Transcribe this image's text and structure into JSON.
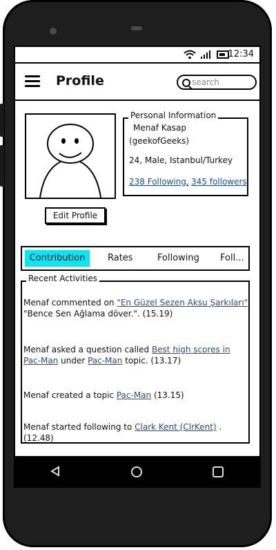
{
  "status_bar": {
    "time": "12:34"
  },
  "app_bar": {
    "title": "Profile",
    "search_placeholder": "search"
  },
  "profile": {
    "edit_button": "Edit Profile",
    "info_legend": "Personal Information",
    "name": "Menaf Kasap",
    "handle": "(geekofGeeks)",
    "details": "24, Male, Istanbul/Turkey",
    "following": "238 Following,",
    "followers": "345 followers"
  },
  "tabs": {
    "contribution": "Contribution",
    "rates": "Rates",
    "following": "Following",
    "followers": "Foll..."
  },
  "activities": {
    "legend": "Recent Activities",
    "items": [
      {
        "pre": "Menaf commented on ",
        "link": "\"En Güzel Sezen Aksu Şarkıları\"",
        "post": ",",
        "line2": "\"Bence Sen Ağlama döver.\". (15.19)"
      },
      {
        "pre": "Menaf asked a question called ",
        "link": "Best high scores in",
        "link2": "Pac-Man",
        "mid": " under ",
        "link3": "Pac-Man",
        "post": " topic. (13.17)"
      },
      {
        "pre": "Menaf created a topic ",
        "link": "Pac-Man",
        "post": " (13.15)"
      },
      {
        "pre": "Menaf started following to ",
        "link": "Clark Kent (ClrKent)",
        "post": " .(12.48)"
      }
    ]
  },
  "icons": {
    "menu": "hamburger-menu-icon",
    "search": "search-icon",
    "back": "back-triangle-icon",
    "home": "home-circle-icon",
    "recent": "recent-square-icon"
  }
}
